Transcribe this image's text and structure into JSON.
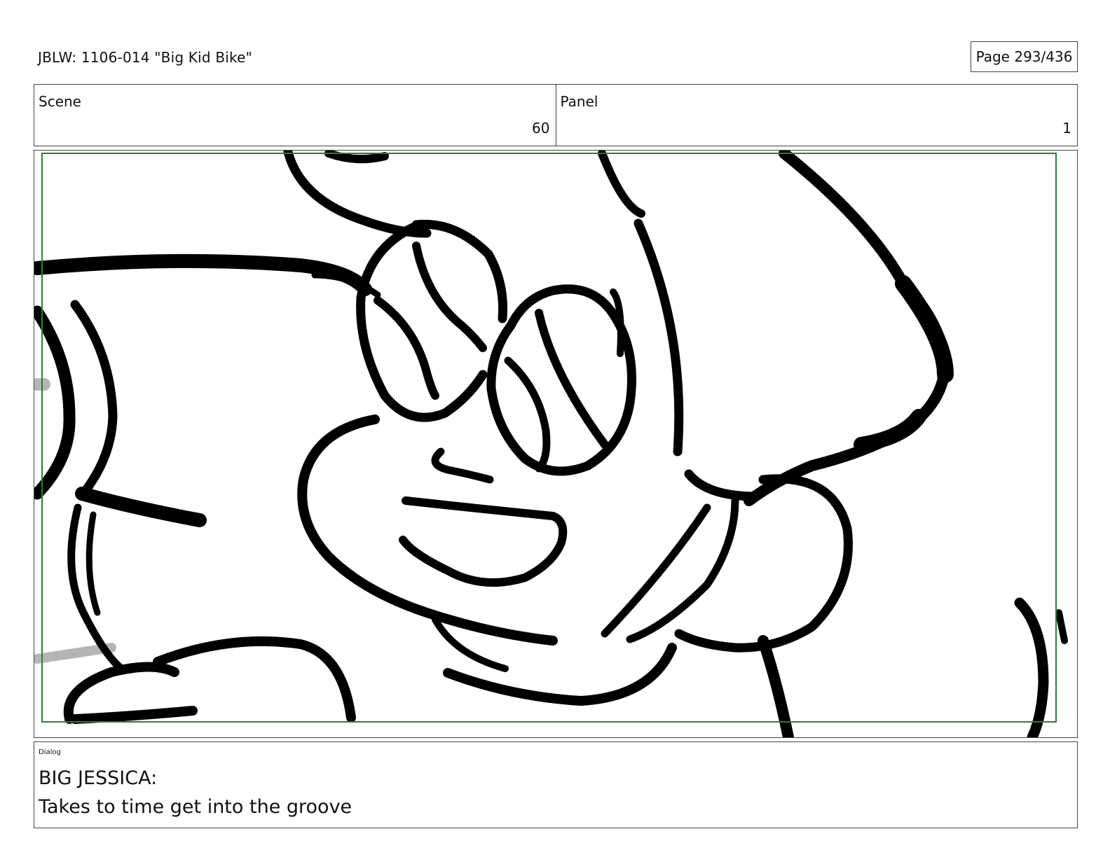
{
  "header": {
    "title": "JBLW: 1106-014 \"Big Kid Bike\"",
    "page": "Page 293/436"
  },
  "info": {
    "scene_label": "Scene",
    "scene_value": "60",
    "panel_label": "Panel",
    "panel_value": "1"
  },
  "panel": {
    "drawing": "storyboard-sketch",
    "safe_area_color": "#2e7d32",
    "line_color": "#000000",
    "tone_color": "#b5b5b5"
  },
  "dialog": {
    "label": "Dialog",
    "speaker": "BIG JESSICA:",
    "line": "Takes to time get into the groove"
  }
}
